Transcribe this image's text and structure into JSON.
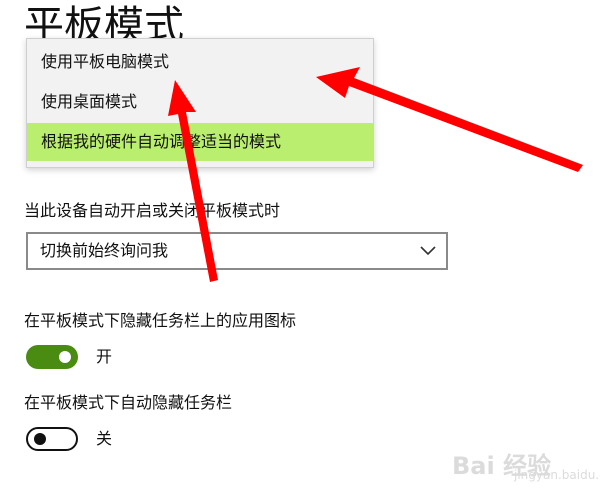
{
  "page": {
    "title": "平板模式"
  },
  "login_dropdown": {
    "options": [
      "使用平板电脑模式",
      "使用桌面模式",
      "根据我的硬件自动调整适当的模式"
    ],
    "selected_index": 2,
    "highlight_color": "#b9ee6f"
  },
  "switch_behavior": {
    "label": "当此设备自动开启或关闭平板模式时",
    "value": "切换前始终询问我"
  },
  "hide_app_icons": {
    "label": "在平板模式下隐藏任务栏上的应用图标",
    "state": "开",
    "on": true,
    "accent": "#4a8b12"
  },
  "auto_hide_taskbar": {
    "label": "在平板模式下自动隐藏任务栏",
    "state": "关",
    "on": false
  },
  "annotation": {
    "arrow_color": "#ff0000"
  },
  "watermark": {
    "text": "Bai 经验",
    "sub": "jingyan.baidu.com"
  }
}
